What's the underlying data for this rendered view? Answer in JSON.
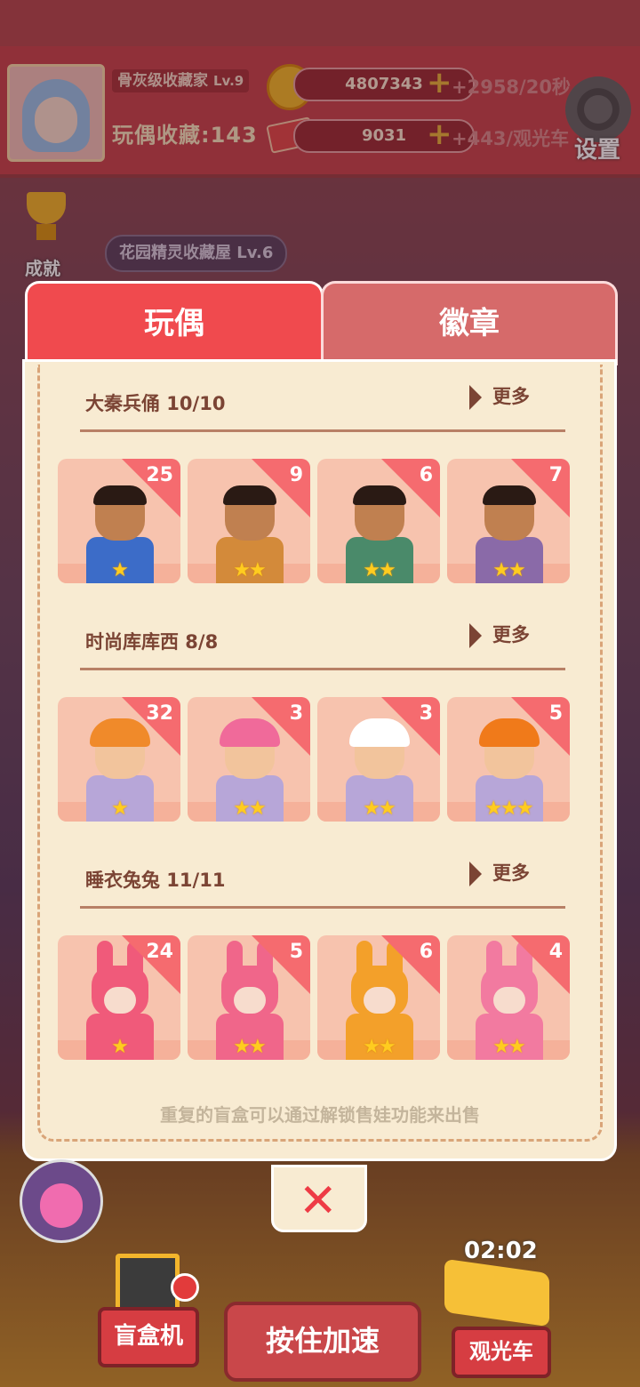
{
  "header": {
    "rank_title": "骨灰级收藏家",
    "rank_level": "Lv.9",
    "collection_label": "玩偶收藏",
    "collection_count": ":143",
    "coins": "4807343",
    "coin_rate": "+2958/20秒",
    "tickets": "9031",
    "ticket_rate": "+443/观光车",
    "plus": "+",
    "settings_label": "设置"
  },
  "side": {
    "achievement_label": "成就",
    "house_label": "花园精灵收藏屋 Lv.6"
  },
  "tabs": [
    {
      "label": "玩偶",
      "active": true
    },
    {
      "label": "徽章",
      "active": false
    }
  ],
  "sections": [
    {
      "title": "大秦兵俑 10/10",
      "more": "更多",
      "items": [
        {
          "count": "25",
          "stars": "★",
          "type": "warrior",
          "color": "#3c6cc8"
        },
        {
          "count": "9",
          "stars": "★★",
          "type": "warrior",
          "color": "#d38a3a"
        },
        {
          "count": "6",
          "stars": "★★",
          "type": "warrior",
          "color": "#4a8a6a"
        },
        {
          "count": "7",
          "stars": "★★",
          "type": "warrior",
          "color": "#8a6aa8"
        }
      ]
    },
    {
      "title": "时尚库库西 8/8",
      "more": "更多",
      "items": [
        {
          "count": "32",
          "stars": "★",
          "type": "kid",
          "color": "#f08a2a"
        },
        {
          "count": "3",
          "stars": "★★",
          "type": "kid",
          "color": "#f06a9a"
        },
        {
          "count": "3",
          "stars": "★★",
          "type": "kid",
          "color": "#ffffff"
        },
        {
          "count": "5",
          "stars": "★★★",
          "type": "kid",
          "color": "#f07a1a"
        }
      ]
    },
    {
      "title": "睡衣兔兔 11/11",
      "more": "更多",
      "items": [
        {
          "count": "24",
          "stars": "★",
          "type": "bunny",
          "color": "#f05a7a"
        },
        {
          "count": "5",
          "stars": "★★",
          "type": "bunny",
          "color": "#f0668a"
        },
        {
          "count": "6",
          "stars": "★★",
          "type": "bunny",
          "color": "#f3a02a"
        },
        {
          "count": "4",
          "stars": "★★",
          "type": "bunny",
          "color": "#f27aa0"
        }
      ]
    }
  ],
  "footer_note": "重复的盲盒可以通过解锁售娃功能来出售",
  "close_label": "✕",
  "bottom": {
    "blind_box_label": "盲盒机",
    "hold_label": "按住加速",
    "tour_label": "观光车",
    "timer": "02:02"
  },
  "icons": [
    "avatar",
    "coin-icon",
    "ticket-icon",
    "gear-icon",
    "trophy-icon",
    "close-icon",
    "vending-machine-icon",
    "tram-icon"
  ]
}
